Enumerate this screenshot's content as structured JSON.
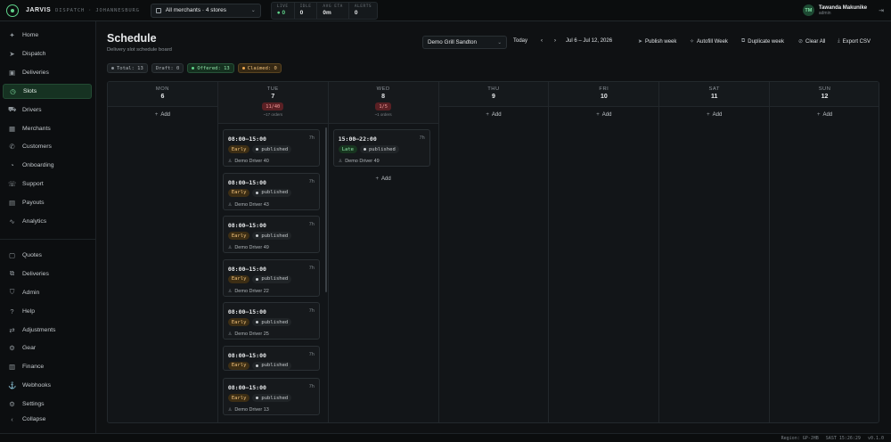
{
  "app": {
    "brand": "JARVIS",
    "subtitle": "DISPATCH · JOHANNESBURG"
  },
  "merchant_selector": {
    "label": "All merchants · 4 stores",
    "icon": "store-icon"
  },
  "stats": [
    {
      "key": "LIVE",
      "value": "● 0",
      "highlight": true
    },
    {
      "key": "IDLE",
      "value": "0",
      "highlight": false
    },
    {
      "key": "AVG ETA",
      "value": "0m",
      "highlight": false
    },
    {
      "key": "ALERTS",
      "value": "0",
      "highlight": false
    }
  ],
  "user": {
    "initials": "TM",
    "name": "Tawanda Makunike",
    "role": "admin"
  },
  "sidebar": {
    "items": [
      {
        "label": "Home",
        "icon": "home-icon",
        "glyph": "✦",
        "active": false
      },
      {
        "label": "Dispatch",
        "icon": "dispatch-icon",
        "glyph": "➤",
        "active": false
      },
      {
        "label": "Deliveries",
        "icon": "package-icon",
        "glyph": "▣",
        "active": false
      },
      {
        "label": "Slots",
        "icon": "clock-icon",
        "glyph": "◷",
        "active": true
      },
      {
        "label": "Drivers",
        "icon": "truck-icon",
        "glyph": "⛟",
        "active": false
      },
      {
        "label": "Merchants",
        "icon": "building-icon",
        "glyph": "▦",
        "active": false
      },
      {
        "label": "Customers",
        "icon": "phone-icon",
        "glyph": "✆",
        "active": false
      },
      {
        "label": "Onboarding",
        "icon": "onboarding-icon",
        "glyph": "◔",
        "active": false
      },
      {
        "label": "Support",
        "icon": "support-icon",
        "glyph": "☏",
        "active": false
      },
      {
        "label": "Payouts",
        "icon": "payouts-icon",
        "glyph": "▤",
        "active": false
      },
      {
        "label": "Analytics",
        "icon": "analytics-icon",
        "glyph": "∿",
        "active": false
      },
      {
        "label": "Quotes",
        "icon": "quotes-icon",
        "glyph": "▢",
        "active": false
      },
      {
        "label": "Deliveries",
        "icon": "deliveries-icon",
        "glyph": "⧉",
        "active": false
      },
      {
        "label": "Admin",
        "icon": "shield-icon",
        "glyph": "⛉",
        "active": false
      },
      {
        "label": "Help",
        "icon": "help-icon",
        "glyph": "?",
        "active": false
      },
      {
        "label": "Adjustments",
        "icon": "adjustments-icon",
        "glyph": "⇄",
        "active": false
      },
      {
        "label": "Gear",
        "icon": "gear-icon",
        "glyph": "⚙",
        "active": false
      },
      {
        "label": "Finance",
        "icon": "finance-icon",
        "glyph": "▥",
        "active": false
      },
      {
        "label": "Webhooks",
        "icon": "webhooks-icon",
        "glyph": "⚓",
        "active": false
      },
      {
        "label": "Settings",
        "icon": "settings-icon",
        "glyph": "⚙",
        "active": false
      },
      {
        "label": "Collapse",
        "icon": "collapse-icon",
        "glyph": "‹",
        "active": false
      }
    ]
  },
  "page": {
    "title": "Schedule",
    "subtitle": "Delivery slot schedule board"
  },
  "chips": [
    {
      "label": "Total: 13",
      "dot": "#8b9298",
      "style": ""
    },
    {
      "label": "Draft: 0",
      "dot": "",
      "style": ""
    },
    {
      "label": "Offered: 13",
      "dot": "#5fd38a",
      "style": "off"
    },
    {
      "label": "Claimed: 0",
      "dot": "#f1a94e",
      "style": "cl"
    }
  ],
  "toolbar": {
    "store": "Demo Grill Sandton",
    "today": "Today",
    "prev": "‹",
    "next": "›",
    "range": "Jul 6 – Jul 12, 2026",
    "publish": "Publish week",
    "autofill": "Autofill Week",
    "duplicate": "Duplicate week",
    "clear": "Clear All",
    "export": "Export CSV"
  },
  "add_label": "Add",
  "days": [
    {
      "name": "MON",
      "date": "6",
      "badge": "",
      "orders": "",
      "slots": []
    },
    {
      "name": "TUE",
      "date": "7",
      "badge": "11/40",
      "orders": "~17 orders",
      "slots": [
        {
          "time": "08:00–15:00",
          "dur": "7h",
          "tag": "Early",
          "status": "published",
          "driver": "Demo Driver 40"
        },
        {
          "time": "08:00–15:00",
          "dur": "7h",
          "tag": "Early",
          "status": "published",
          "driver": "Demo Driver 43"
        },
        {
          "time": "08:00–15:00",
          "dur": "7h",
          "tag": "Early",
          "status": "published",
          "driver": "Demo Driver 49"
        },
        {
          "time": "08:00–15:00",
          "dur": "7h",
          "tag": "Early",
          "status": "published",
          "driver": "Demo Driver 22"
        },
        {
          "time": "08:00–15:00",
          "dur": "7h",
          "tag": "Early",
          "status": "published",
          "driver": "Demo Driver 25"
        },
        {
          "time": "08:00–15:00",
          "dur": "7h",
          "tag": "Early",
          "status": "published",
          "driver": ""
        },
        {
          "time": "08:00–15:00",
          "dur": "7h",
          "tag": "Early",
          "status": "published",
          "driver": "Demo Driver 13"
        }
      ]
    },
    {
      "name": "WED",
      "date": "8",
      "badge": "1/5",
      "orders": "~1 orders",
      "slots": [
        {
          "time": "15:00–22:00",
          "dur": "7h",
          "tag": "Late",
          "status": "published",
          "driver": "Demo Driver 49"
        }
      ]
    },
    {
      "name": "THU",
      "date": "9",
      "badge": "",
      "orders": "",
      "slots": []
    },
    {
      "name": "FRI",
      "date": "10",
      "badge": "",
      "orders": "",
      "slots": []
    },
    {
      "name": "SAT",
      "date": "11",
      "badge": "",
      "orders": "",
      "slots": []
    },
    {
      "name": "SUN",
      "date": "12",
      "badge": "",
      "orders": "",
      "slots": []
    }
  ],
  "statusbar": {
    "region": "Region: GP-JHB",
    "time": "SAST 15:26:29",
    "version": "v0.1.0"
  }
}
